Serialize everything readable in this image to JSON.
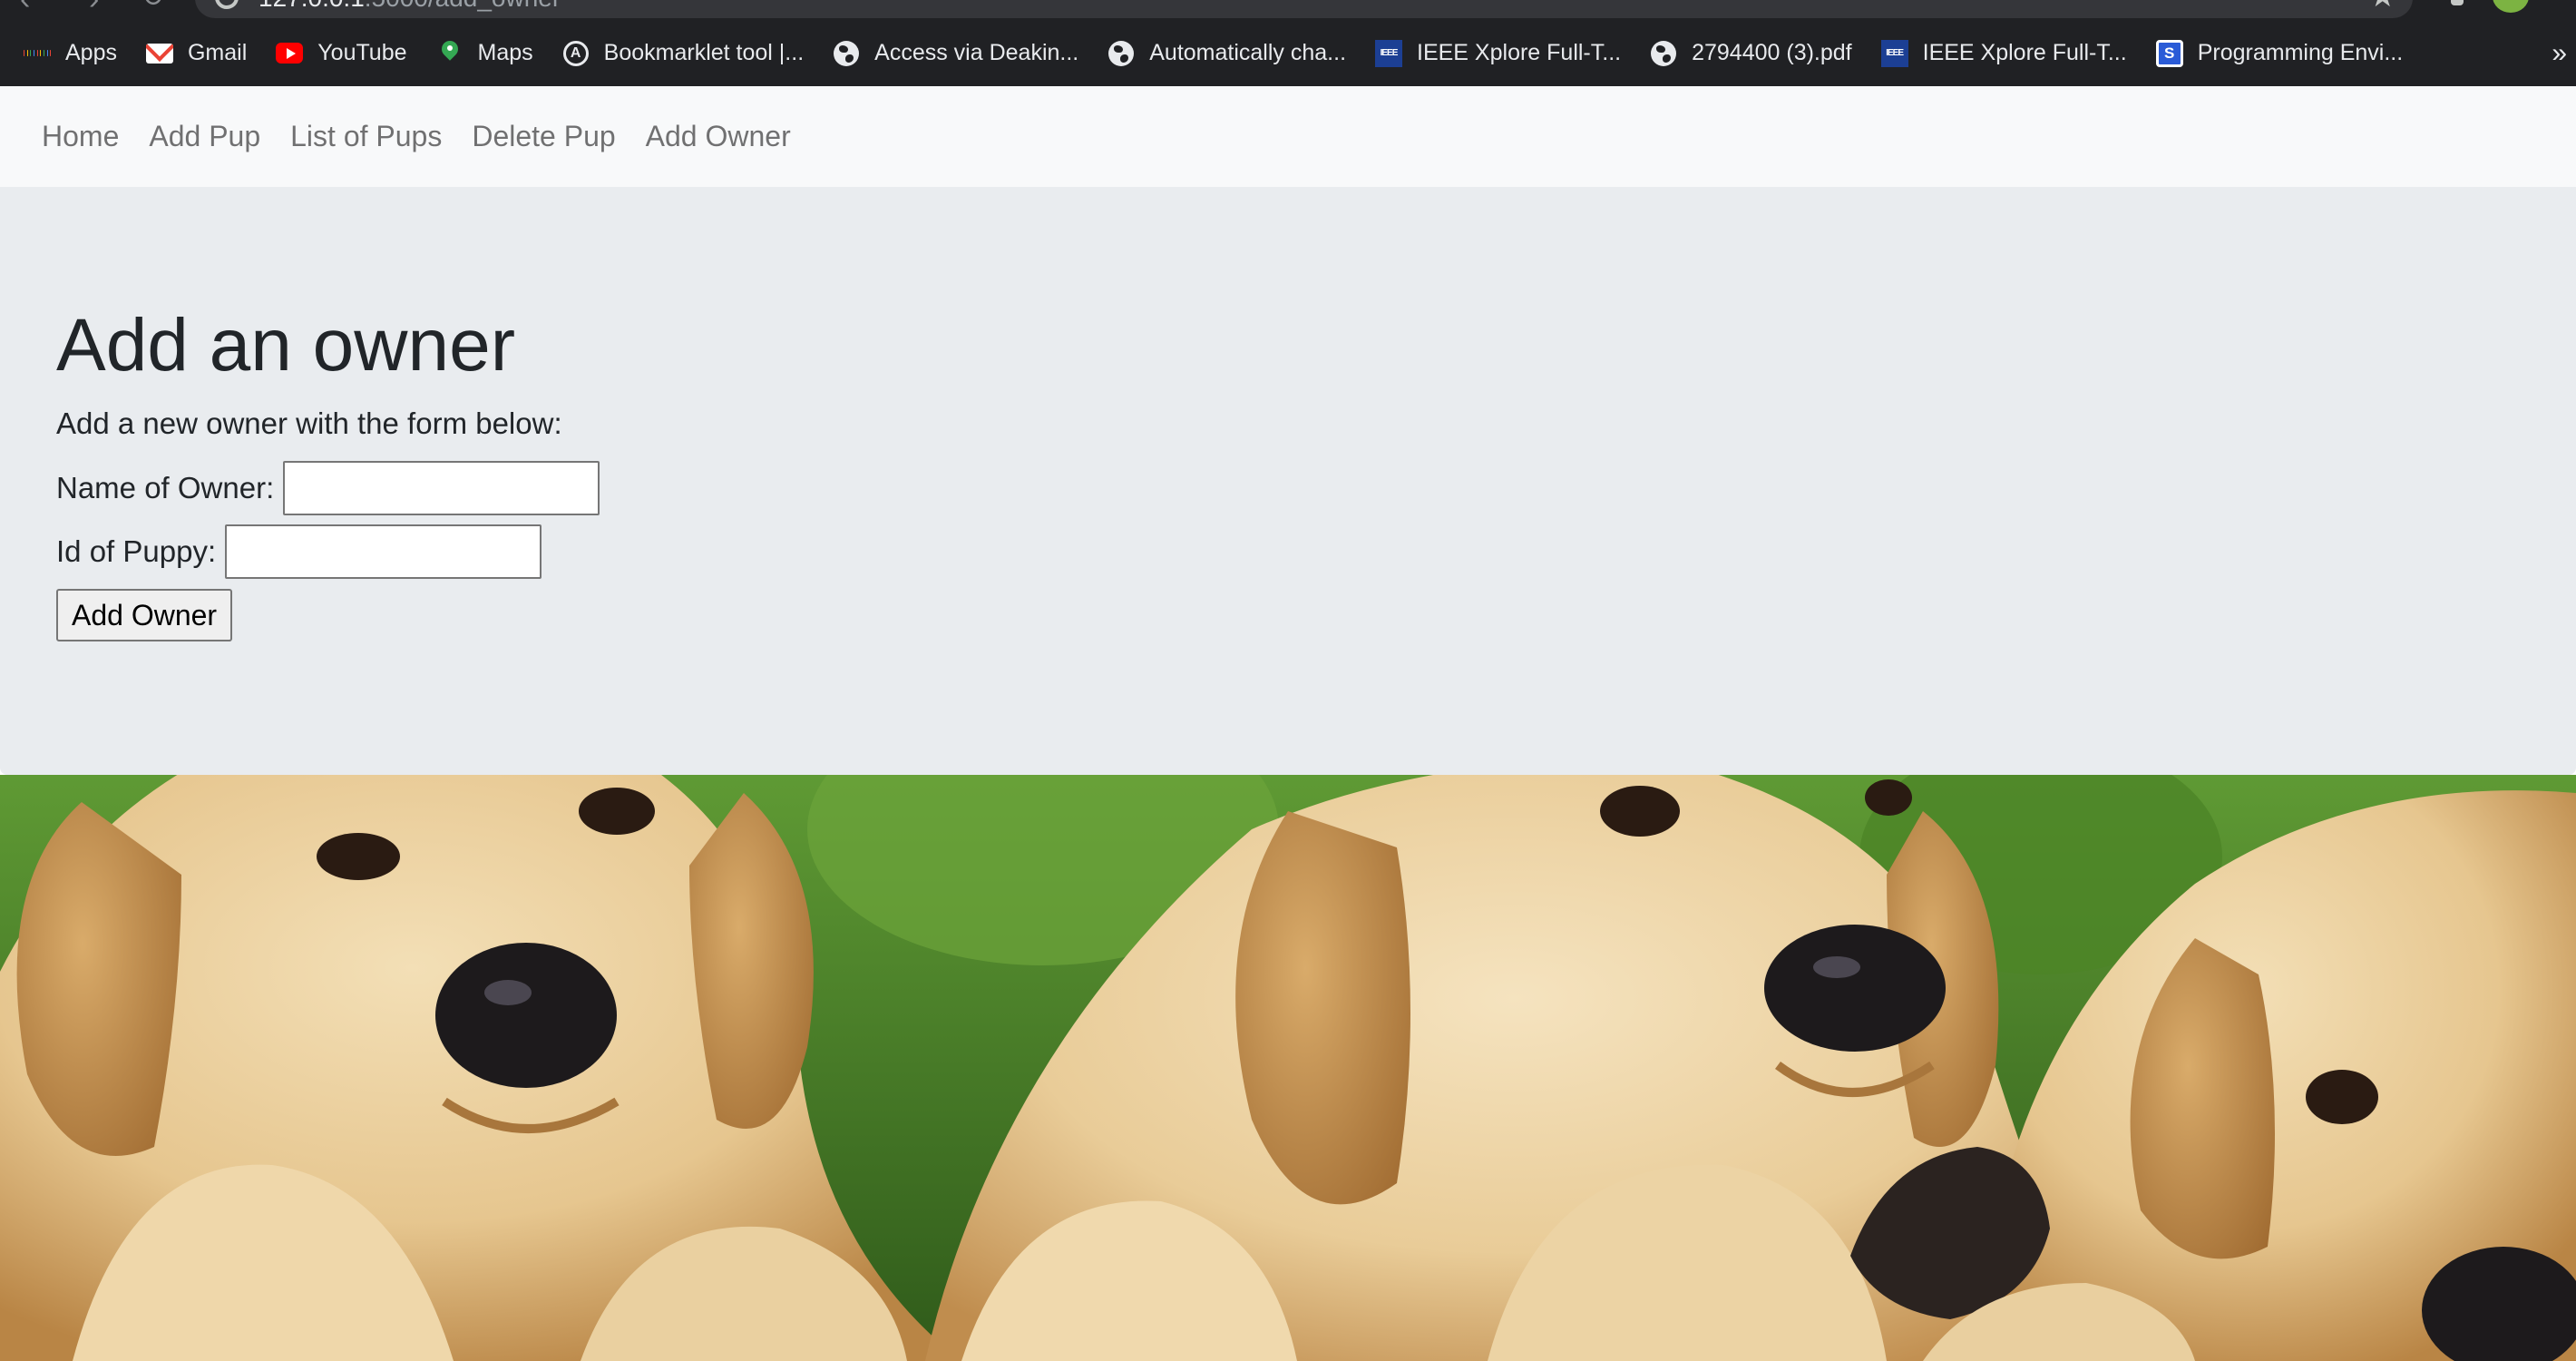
{
  "browser": {
    "url_host": "127.0.0.1",
    "url_path": ":5000/add_owner",
    "bookmarks": [
      {
        "label": "Apps",
        "icon": "apps-grid-icon"
      },
      {
        "label": "Gmail",
        "icon": "gmail-icon"
      },
      {
        "label": "YouTube",
        "icon": "youtube-icon"
      },
      {
        "label": "Maps",
        "icon": "maps-pin-icon"
      },
      {
        "label": "Bookmarklet tool |...",
        "icon": "bookmarklet-icon"
      },
      {
        "label": "Access via Deakin...",
        "icon": "globe-icon"
      },
      {
        "label": "Automatically cha...",
        "icon": "globe-icon"
      },
      {
        "label": "IEEE Xplore Full-T...",
        "icon": "ieee-icon"
      },
      {
        "label": "2794400 (3).pdf",
        "icon": "globe-icon"
      },
      {
        "label": "IEEE Xplore Full-T...",
        "icon": "ieee-icon"
      },
      {
        "label": "Programming Envi...",
        "icon": "programming-env-icon"
      }
    ],
    "ieee_icon_text": "IEEE",
    "more_glyph": "»"
  },
  "navbar": {
    "links": [
      "Home",
      "Add Pup",
      "List of Pups",
      "Delete Pup",
      "Add Owner"
    ],
    "link_color": "#6c757d",
    "background": "#f8f9fa"
  },
  "main": {
    "title": "Add an owner",
    "lead": "Add a new owner with the form below:",
    "form": {
      "owner_label": "Name of Owner:",
      "owner_value": "",
      "puppy_label": "Id of Puppy:",
      "puppy_value": "",
      "submit_label": "Add Owner"
    },
    "background": "#e9ecef"
  },
  "hero": {
    "subject": "three golden retriever puppies on grass",
    "colors": {
      "grass": "#4f8a2a",
      "fur_light": "#e9cfa0",
      "fur_dark": "#c99a5c",
      "nose": "#1d1a1c"
    }
  }
}
